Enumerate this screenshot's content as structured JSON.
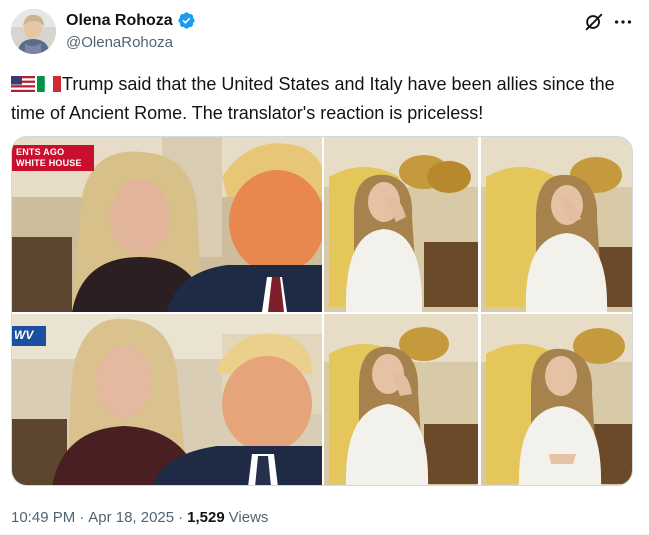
{
  "author": {
    "name": "Olena Rohoza",
    "handle": "@OlenaRohoza",
    "verified": true
  },
  "post": {
    "flags": [
      "us-flag",
      "italy-flag"
    ],
    "text": "Trump said that the United States and Italy have been allies since the time of Ancient Rome. The translator's reaction is priceless!",
    "media": {
      "news_banner": [
        "ENTS AGO",
        "WHITE HOUSE"
      ],
      "corner_logo": "WV"
    }
  },
  "meta": {
    "time": "10:49 PM",
    "separator": "·",
    "date": "Apr 18, 2025",
    "views_count": "1,529",
    "views_label": "Views"
  },
  "colors": {
    "text": "#0f1419",
    "muted": "#536471",
    "verified": "#1d9bf0",
    "border": "#cfd9de"
  }
}
